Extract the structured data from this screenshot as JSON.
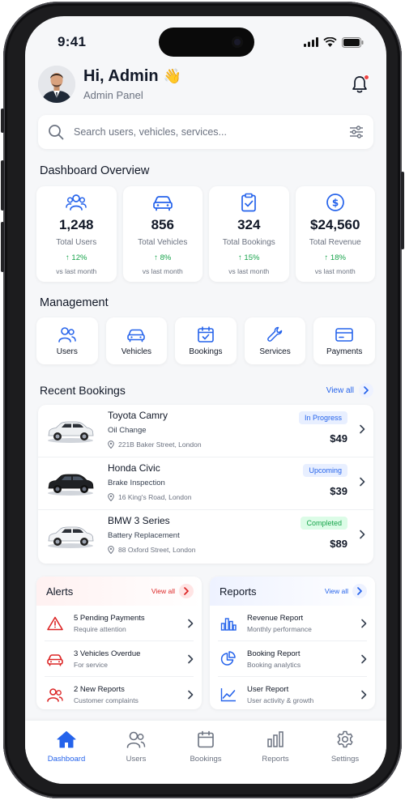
{
  "status_bar": {
    "time": "9:41"
  },
  "header": {
    "greeting": "Hi, Admin",
    "emoji": "👋",
    "subtitle": "Admin Panel"
  },
  "search": {
    "placeholder": "Search users, vehicles, services..."
  },
  "overview": {
    "title": "Dashboard Overview",
    "cards": [
      {
        "icon": "users-icon",
        "value": "1,248",
        "label": "Total Users",
        "change": "↑ 12%",
        "note": "vs last month"
      },
      {
        "icon": "car-icon",
        "value": "856",
        "label": "Total Vehicles",
        "change": "↑ 8%",
        "note": "vs last month"
      },
      {
        "icon": "clipboard-check-icon",
        "value": "324",
        "label": "Total Bookings",
        "change": "↑ 15%",
        "note": "vs last month"
      },
      {
        "icon": "dollar-icon",
        "value": "$24,560",
        "label": "Total Revenue",
        "change": "↑ 18%",
        "note": "vs last month"
      }
    ]
  },
  "management": {
    "title": "Management",
    "items": [
      {
        "icon": "users-icon",
        "label": "Users"
      },
      {
        "icon": "car-icon",
        "label": "Vehicles"
      },
      {
        "icon": "calendar-check-icon",
        "label": "Bookings"
      },
      {
        "icon": "wrench-icon",
        "label": "Services"
      },
      {
        "icon": "wallet-icon",
        "label": "Payments"
      }
    ]
  },
  "recent_bookings": {
    "title": "Recent Bookings",
    "view_all": "View all",
    "items": [
      {
        "car": "Toyota Camry",
        "service": "Oil Change",
        "address": "221B Baker Street, London",
        "status": "In Progress",
        "price": "$49",
        "car_color": "#f1f2f4"
      },
      {
        "car": "Honda Civic",
        "service": "Brake Inspection",
        "address": "16 King's Road, London",
        "status": "Upcoming",
        "price": "$39",
        "car_color": "#1f2124"
      },
      {
        "car": "BMW 3 Series",
        "service": "Battery Replacement",
        "address": "88 Oxford Street, London",
        "status": "Completed",
        "price": "$89",
        "car_color": "#f3f4f6"
      }
    ]
  },
  "alerts": {
    "title": "Alerts",
    "view_all": "View all",
    "items": [
      {
        "icon": "warning-icon",
        "title": "5 Pending Payments",
        "subtitle": "Require attention"
      },
      {
        "icon": "car-icon",
        "title": "3 Vehicles Overdue",
        "subtitle": "For service"
      },
      {
        "icon": "users-icon",
        "title": "2 New Reports",
        "subtitle": "Customer complaints"
      }
    ]
  },
  "reports": {
    "title": "Reports",
    "view_all": "View all",
    "items": [
      {
        "icon": "bar-chart-icon",
        "title": "Revenue Report",
        "subtitle": "Monthly performance"
      },
      {
        "icon": "pie-chart-icon",
        "title": "Booking Report",
        "subtitle": "Booking analytics"
      },
      {
        "icon": "line-chart-icon",
        "title": "User Report",
        "subtitle": "User activity & growth"
      }
    ]
  },
  "tabbar": {
    "tabs": [
      {
        "icon": "home-icon",
        "label": "Dashboard",
        "active": true
      },
      {
        "icon": "users-icon",
        "label": "Users"
      },
      {
        "icon": "calendar-icon",
        "label": "Bookings"
      },
      {
        "icon": "bar-chart-icon",
        "label": "Reports"
      },
      {
        "icon": "gear-icon",
        "label": "Settings"
      }
    ]
  },
  "colors": {
    "accent": "#2563eb",
    "positive": "#16a34a",
    "alert": "#dc2626",
    "status_in_progress_bg": "#e8efff",
    "status_upcoming_bg": "#e8efff",
    "status_completed_bg": "#dcfce7",
    "status_completed_text": "#16a34a"
  }
}
